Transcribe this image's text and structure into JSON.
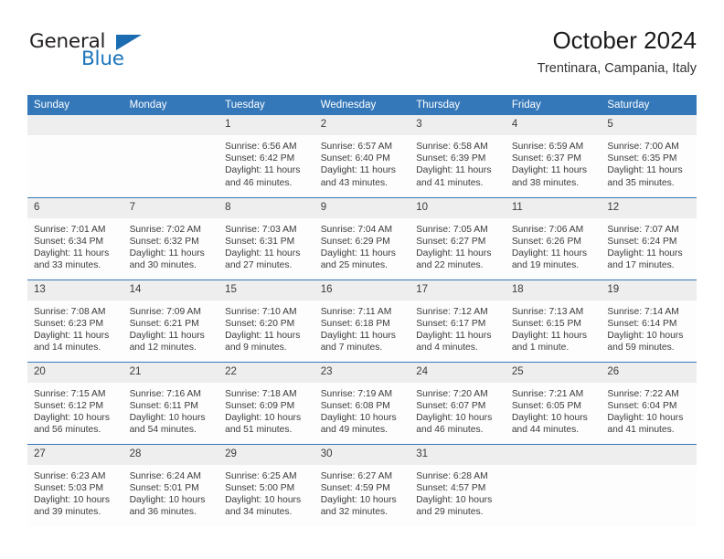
{
  "brand": {
    "logo_primary": "General",
    "logo_secondary": "Blue",
    "logo_icon": "triangle-flag-icon"
  },
  "header": {
    "title": "October 2024",
    "subtitle": "Trentinara, Campania, Italy"
  },
  "colors": {
    "header_blue": "#3578b9",
    "logo_blue": "#1b75bb",
    "daynum_band": "#eeeeee",
    "text": "#3b3b3b"
  },
  "weekdays": [
    "Sunday",
    "Monday",
    "Tuesday",
    "Wednesday",
    "Thursday",
    "Friday",
    "Saturday"
  ],
  "labels": {
    "sunrise_prefix": "Sunrise: ",
    "sunset_prefix": "Sunset: ",
    "daylight_prefix": "Daylight: "
  },
  "weeks": [
    [
      {
        "day": "",
        "blank": true
      },
      {
        "day": "",
        "blank": true
      },
      {
        "day": "1",
        "sunrise": "Sunrise: 6:56 AM",
        "sunset": "Sunset: 6:42 PM",
        "daylight": "Daylight: 11 hours and 46 minutes."
      },
      {
        "day": "2",
        "sunrise": "Sunrise: 6:57 AM",
        "sunset": "Sunset: 6:40 PM",
        "daylight": "Daylight: 11 hours and 43 minutes."
      },
      {
        "day": "3",
        "sunrise": "Sunrise: 6:58 AM",
        "sunset": "Sunset: 6:39 PM",
        "daylight": "Daylight: 11 hours and 41 minutes."
      },
      {
        "day": "4",
        "sunrise": "Sunrise: 6:59 AM",
        "sunset": "Sunset: 6:37 PM",
        "daylight": "Daylight: 11 hours and 38 minutes."
      },
      {
        "day": "5",
        "sunrise": "Sunrise: 7:00 AM",
        "sunset": "Sunset: 6:35 PM",
        "daylight": "Daylight: 11 hours and 35 minutes."
      }
    ],
    [
      {
        "day": "6",
        "sunrise": "Sunrise: 7:01 AM",
        "sunset": "Sunset: 6:34 PM",
        "daylight": "Daylight: 11 hours and 33 minutes."
      },
      {
        "day": "7",
        "sunrise": "Sunrise: 7:02 AM",
        "sunset": "Sunset: 6:32 PM",
        "daylight": "Daylight: 11 hours and 30 minutes."
      },
      {
        "day": "8",
        "sunrise": "Sunrise: 7:03 AM",
        "sunset": "Sunset: 6:31 PM",
        "daylight": "Daylight: 11 hours and 27 minutes."
      },
      {
        "day": "9",
        "sunrise": "Sunrise: 7:04 AM",
        "sunset": "Sunset: 6:29 PM",
        "daylight": "Daylight: 11 hours and 25 minutes."
      },
      {
        "day": "10",
        "sunrise": "Sunrise: 7:05 AM",
        "sunset": "Sunset: 6:27 PM",
        "daylight": "Daylight: 11 hours and 22 minutes."
      },
      {
        "day": "11",
        "sunrise": "Sunrise: 7:06 AM",
        "sunset": "Sunset: 6:26 PM",
        "daylight": "Daylight: 11 hours and 19 minutes."
      },
      {
        "day": "12",
        "sunrise": "Sunrise: 7:07 AM",
        "sunset": "Sunset: 6:24 PM",
        "daylight": "Daylight: 11 hours and 17 minutes."
      }
    ],
    [
      {
        "day": "13",
        "sunrise": "Sunrise: 7:08 AM",
        "sunset": "Sunset: 6:23 PM",
        "daylight": "Daylight: 11 hours and 14 minutes."
      },
      {
        "day": "14",
        "sunrise": "Sunrise: 7:09 AM",
        "sunset": "Sunset: 6:21 PM",
        "daylight": "Daylight: 11 hours and 12 minutes."
      },
      {
        "day": "15",
        "sunrise": "Sunrise: 7:10 AM",
        "sunset": "Sunset: 6:20 PM",
        "daylight": "Daylight: 11 hours and 9 minutes."
      },
      {
        "day": "16",
        "sunrise": "Sunrise: 7:11 AM",
        "sunset": "Sunset: 6:18 PM",
        "daylight": "Daylight: 11 hours and 7 minutes."
      },
      {
        "day": "17",
        "sunrise": "Sunrise: 7:12 AM",
        "sunset": "Sunset: 6:17 PM",
        "daylight": "Daylight: 11 hours and 4 minutes."
      },
      {
        "day": "18",
        "sunrise": "Sunrise: 7:13 AM",
        "sunset": "Sunset: 6:15 PM",
        "daylight": "Daylight: 11 hours and 1 minute."
      },
      {
        "day": "19",
        "sunrise": "Sunrise: 7:14 AM",
        "sunset": "Sunset: 6:14 PM",
        "daylight": "Daylight: 10 hours and 59 minutes."
      }
    ],
    [
      {
        "day": "20",
        "sunrise": "Sunrise: 7:15 AM",
        "sunset": "Sunset: 6:12 PM",
        "daylight": "Daylight: 10 hours and 56 minutes."
      },
      {
        "day": "21",
        "sunrise": "Sunrise: 7:16 AM",
        "sunset": "Sunset: 6:11 PM",
        "daylight": "Daylight: 10 hours and 54 minutes."
      },
      {
        "day": "22",
        "sunrise": "Sunrise: 7:18 AM",
        "sunset": "Sunset: 6:09 PM",
        "daylight": "Daylight: 10 hours and 51 minutes."
      },
      {
        "day": "23",
        "sunrise": "Sunrise: 7:19 AM",
        "sunset": "Sunset: 6:08 PM",
        "daylight": "Daylight: 10 hours and 49 minutes."
      },
      {
        "day": "24",
        "sunrise": "Sunrise: 7:20 AM",
        "sunset": "Sunset: 6:07 PM",
        "daylight": "Daylight: 10 hours and 46 minutes."
      },
      {
        "day": "25",
        "sunrise": "Sunrise: 7:21 AM",
        "sunset": "Sunset: 6:05 PM",
        "daylight": "Daylight: 10 hours and 44 minutes."
      },
      {
        "day": "26",
        "sunrise": "Sunrise: 7:22 AM",
        "sunset": "Sunset: 6:04 PM",
        "daylight": "Daylight: 10 hours and 41 minutes."
      }
    ],
    [
      {
        "day": "27",
        "sunrise": "Sunrise: 6:23 AM",
        "sunset": "Sunset: 5:03 PM",
        "daylight": "Daylight: 10 hours and 39 minutes."
      },
      {
        "day": "28",
        "sunrise": "Sunrise: 6:24 AM",
        "sunset": "Sunset: 5:01 PM",
        "daylight": "Daylight: 10 hours and 36 minutes."
      },
      {
        "day": "29",
        "sunrise": "Sunrise: 6:25 AM",
        "sunset": "Sunset: 5:00 PM",
        "daylight": "Daylight: 10 hours and 34 minutes."
      },
      {
        "day": "30",
        "sunrise": "Sunrise: 6:27 AM",
        "sunset": "Sunset: 4:59 PM",
        "daylight": "Daylight: 10 hours and 32 minutes."
      },
      {
        "day": "31",
        "sunrise": "Sunrise: 6:28 AM",
        "sunset": "Sunset: 4:57 PM",
        "daylight": "Daylight: 10 hours and 29 minutes."
      },
      {
        "day": "",
        "blank": true
      },
      {
        "day": "",
        "blank": true
      }
    ]
  ]
}
